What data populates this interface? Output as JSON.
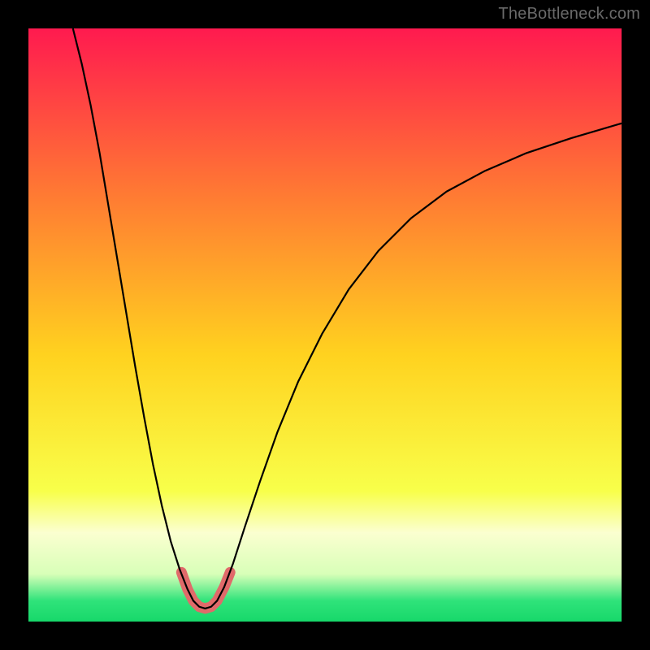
{
  "watermark": "TheBottleneck.com",
  "chart_data": {
    "type": "line",
    "title": "",
    "xlabel": "",
    "ylabel": "",
    "xlim": [
      0,
      1
    ],
    "ylim": [
      0,
      1
    ],
    "background_gradient": {
      "stops": [
        {
          "offset": 0.0,
          "color": "#ff1a4f"
        },
        {
          "offset": 0.28,
          "color": "#ff7a33"
        },
        {
          "offset": 0.55,
          "color": "#ffd21f"
        },
        {
          "offset": 0.78,
          "color": "#f8ff4a"
        },
        {
          "offset": 0.85,
          "color": "#fbffd0"
        },
        {
          "offset": 0.92,
          "color": "#d8ffb8"
        },
        {
          "offset": 0.965,
          "color": "#2fe37a"
        },
        {
          "offset": 1.0,
          "color": "#17d86a"
        }
      ]
    },
    "series": [
      {
        "name": "curve",
        "color": "#000000",
        "width": 2.2,
        "points": [
          {
            "x": 0.075,
            "y": 1.0
          },
          {
            "x": 0.09,
            "y": 0.94
          },
          {
            "x": 0.105,
            "y": 0.87
          },
          {
            "x": 0.12,
            "y": 0.79
          },
          {
            "x": 0.135,
            "y": 0.7
          },
          {
            "x": 0.15,
            "y": 0.61
          },
          {
            "x": 0.165,
            "y": 0.52
          },
          {
            "x": 0.18,
            "y": 0.43
          },
          {
            "x": 0.195,
            "y": 0.345
          },
          {
            "x": 0.21,
            "y": 0.265
          },
          {
            "x": 0.225,
            "y": 0.195
          },
          {
            "x": 0.24,
            "y": 0.135
          },
          {
            "x": 0.255,
            "y": 0.088
          },
          {
            "x": 0.268,
            "y": 0.055
          },
          {
            "x": 0.278,
            "y": 0.035
          },
          {
            "x": 0.288,
            "y": 0.025
          },
          {
            "x": 0.298,
            "y": 0.022
          },
          {
            "x": 0.308,
            "y": 0.025
          },
          {
            "x": 0.318,
            "y": 0.035
          },
          {
            "x": 0.33,
            "y": 0.058
          },
          {
            "x": 0.345,
            "y": 0.098
          },
          {
            "x": 0.365,
            "y": 0.16
          },
          {
            "x": 0.39,
            "y": 0.235
          },
          {
            "x": 0.42,
            "y": 0.32
          },
          {
            "x": 0.455,
            "y": 0.405
          },
          {
            "x": 0.495,
            "y": 0.485
          },
          {
            "x": 0.54,
            "y": 0.56
          },
          {
            "x": 0.59,
            "y": 0.625
          },
          {
            "x": 0.645,
            "y": 0.68
          },
          {
            "x": 0.705,
            "y": 0.725
          },
          {
            "x": 0.77,
            "y": 0.76
          },
          {
            "x": 0.84,
            "y": 0.79
          },
          {
            "x": 0.915,
            "y": 0.815
          },
          {
            "x": 1.0,
            "y": 0.84
          }
        ]
      },
      {
        "name": "valley-highlight",
        "color": "#e06a6a",
        "width": 13,
        "linecap": "round",
        "points": [
          {
            "x": 0.258,
            "y": 0.083
          },
          {
            "x": 0.268,
            "y": 0.055
          },
          {
            "x": 0.278,
            "y": 0.035
          },
          {
            "x": 0.288,
            "y": 0.025
          },
          {
            "x": 0.298,
            "y": 0.022
          },
          {
            "x": 0.308,
            "y": 0.025
          },
          {
            "x": 0.318,
            "y": 0.035
          },
          {
            "x": 0.33,
            "y": 0.058
          },
          {
            "x": 0.34,
            "y": 0.083
          }
        ]
      }
    ]
  }
}
